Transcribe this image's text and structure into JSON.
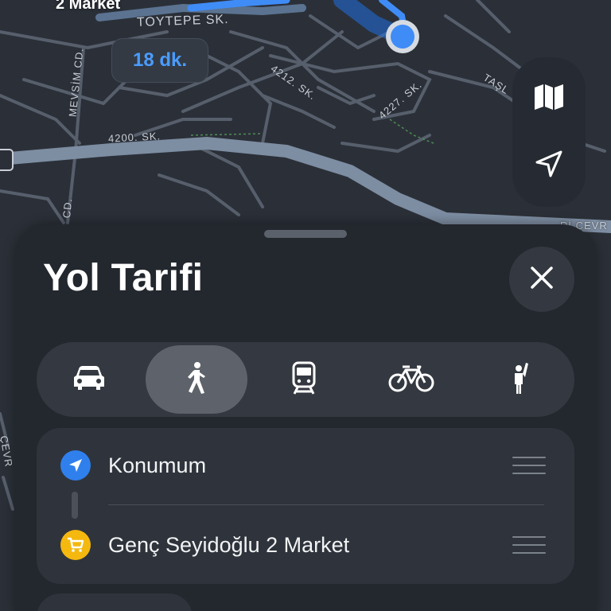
{
  "map": {
    "poi_label": "2 Market",
    "eta": "18 dk.",
    "road_labels": {
      "toytepe": "TOYTEPE SK.",
      "mevsim": "MEVSİM CD.",
      "s4212": "4212. SK.",
      "s4227": "4227. SK.",
      "s4200": "4200. SK.",
      "tasl": "TAŞL",
      "cd": "CD.",
      "cevre": "Rİ ÇEVR",
      "cevr_left": "ÇEVR"
    },
    "controls": [
      {
        "icon": "map-icon"
      },
      {
        "icon": "location-arrow-icon"
      }
    ],
    "colors": {
      "route": "#3f8cf7",
      "user_location": "#3f8cf7",
      "road_major": "#7e8c9f",
      "road_minor": "#5a6270"
    }
  },
  "sheet": {
    "title": "Yol Tarifi",
    "close_icon": "close-icon",
    "modes": [
      {
        "icon": "car-icon",
        "selected": false
      },
      {
        "icon": "walk-icon",
        "selected": true
      },
      {
        "icon": "transit-icon",
        "selected": false
      },
      {
        "icon": "bicycle-icon",
        "selected": false
      },
      {
        "icon": "rideshare-icon",
        "selected": false
      }
    ],
    "route": {
      "origin": {
        "label": "Konumum",
        "icon": "location-arrow-icon",
        "color": "#2f80ed"
      },
      "destination": {
        "label": "Genç Seyidoğlu 2 Market",
        "icon": "cart-icon",
        "color": "#f5b80f"
      }
    }
  }
}
